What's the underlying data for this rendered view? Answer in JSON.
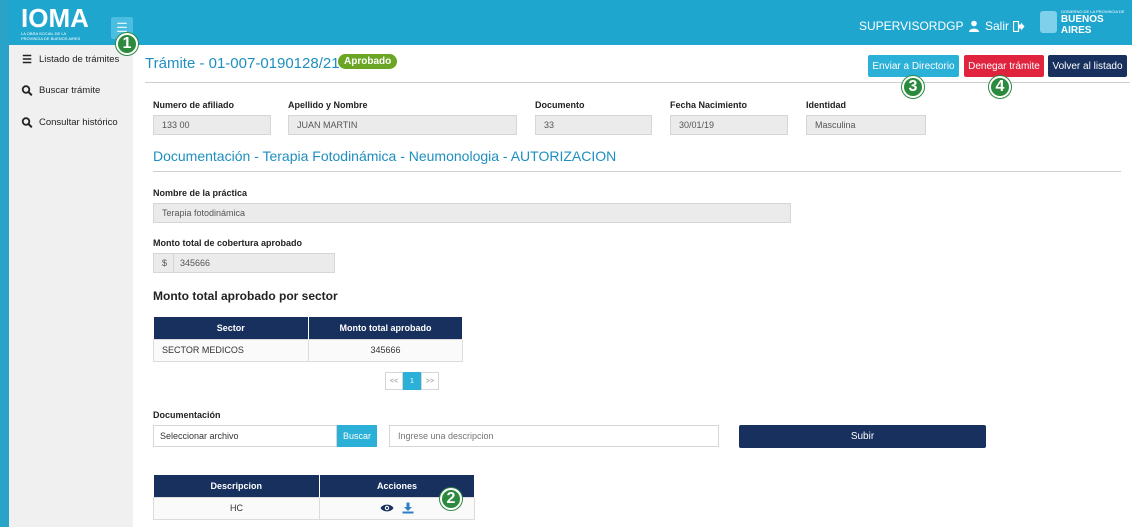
{
  "header": {
    "logo_text": "IOMA",
    "logo_subtext": "LA OBRA SOCIAL DE LA PROVINCIA DE BUENOS AIRES",
    "menu_icon": "hamburger-icon",
    "username": "SUPERVISORDGP",
    "logout_label": "Salir",
    "gov_logo_small": "GOBIERNO DE LA PROVINCIA DE",
    "gov_logo_big": "BUENOS AIRES"
  },
  "sidebar": {
    "items": [
      {
        "label": "Listado de trámites",
        "icon": "list-icon"
      },
      {
        "label": "Buscar trámite",
        "icon": "search-icon"
      },
      {
        "label": "Consultar histórico",
        "icon": "search-icon"
      }
    ]
  },
  "tramite": {
    "title": "Trámite - 01-007-0190128/21",
    "status": "Aprobado",
    "status_color": "#6aa624"
  },
  "actions": {
    "directorio": "Enviar a Directorio",
    "denegar": "Denegar trámite",
    "volver": "Volver al listado"
  },
  "afiliado": {
    "numero_label": "Numero de afiliado",
    "numero_value": "133        00",
    "nombre_label": "Apellido y Nombre",
    "nombre_value": "JUAN MARTIN",
    "documento_label": "Documento",
    "documento_value": "33",
    "fecha_label": "Fecha Nacimiento",
    "fecha_value": "30/01/19",
    "identidad_label": "Identidad",
    "identidad_value": "Masculina"
  },
  "documentacion": {
    "heading": "Documentación - Terapia Fotodinámica - Neumonologia - AUTORIZACION",
    "practica_label": "Nombre de la práctica",
    "practica_value": "Terapia fotodinámica",
    "monto_label": "Monto total de cobertura aprobado",
    "monto_currency": "$",
    "monto_value": "345666"
  },
  "sector_table": {
    "heading": "Monto total aprobado por sector",
    "headers": [
      "Sector",
      "Monto total aprobado"
    ],
    "rows": [
      [
        "SECTOR MEDICOS",
        "345666"
      ]
    ]
  },
  "pager": {
    "prev": "<<",
    "current": "1",
    "next": ">>"
  },
  "upload": {
    "label": "Documentación",
    "file_placeholder": "Seleccionar archivo",
    "browse_label": "Buscar",
    "desc_placeholder": "Ingrese una descripcion",
    "submit_label": "Subir"
  },
  "docs_table": {
    "headers": [
      "Descripcion",
      "Acciones"
    ],
    "rows": [
      {
        "descripcion": "HC",
        "actions": [
          "eye-icon",
          "download-icon"
        ]
      }
    ]
  },
  "callouts": [
    "1",
    "2",
    "3",
    "4"
  ],
  "colors": {
    "topbar": "#1fa6cf",
    "navy": "#17305e",
    "accent": "#2bb0d8",
    "danger": "#e0243e",
    "title": "#1e8fc0"
  }
}
